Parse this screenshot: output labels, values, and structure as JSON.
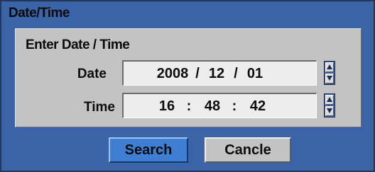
{
  "dialog": {
    "title": "Date/Time",
    "section_label": "Enter Date / Time",
    "date": {
      "label": "Date",
      "year": "2008",
      "sep1": "/",
      "month": "12",
      "sep2": "/",
      "day": "01"
    },
    "time": {
      "label": "Time",
      "hour": "16",
      "sep1": ":",
      "minute": "48",
      "sep2": ":",
      "second": "42"
    },
    "buttons": {
      "search_label": "Search",
      "cancel_label": "Cancle"
    }
  },
  "icons": {
    "spin_up": "triangle-up-icon",
    "spin_down": "triangle-down-icon"
  },
  "colors": {
    "dialog_background": "#3a63a8",
    "panel_background": "#c3c3c3",
    "field_background": "#ededed",
    "search_button": "#3f7fd3"
  }
}
